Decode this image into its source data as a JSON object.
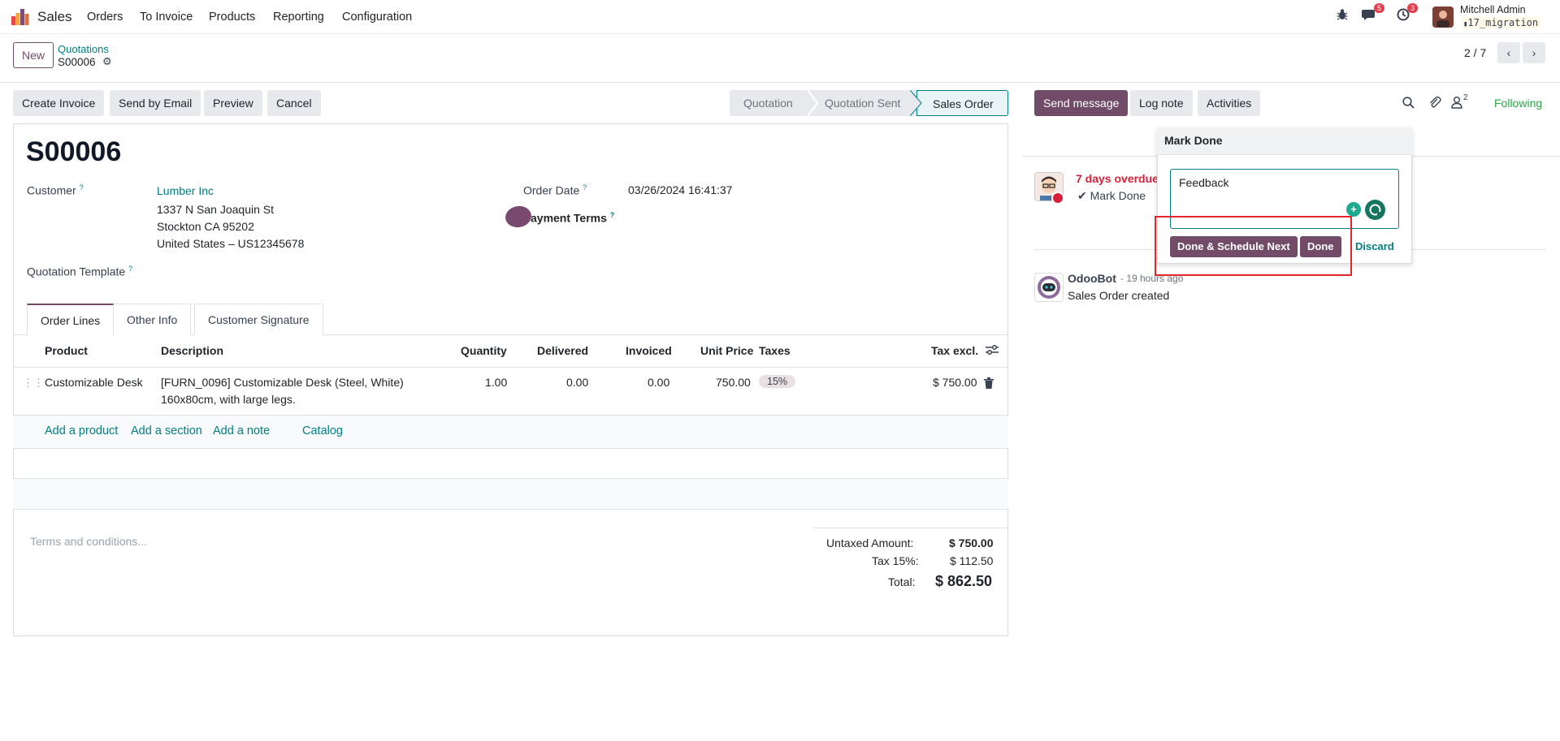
{
  "navbar": {
    "app_name": "Sales",
    "menu": [
      "Orders",
      "To Invoice",
      "Products",
      "Reporting",
      "Configuration"
    ],
    "messages_count": "5",
    "activities_count": "3",
    "user_name": "Mitchell Admin",
    "db_name": "17_migration"
  },
  "control_panel": {
    "new_label": "New",
    "breadcrumb_parent": "Quotations",
    "breadcrumb_current": "S00006",
    "pager": "2 / 7"
  },
  "actions": {
    "create_invoice": "Create Invoice",
    "send_by_email": "Send by Email",
    "preview": "Preview",
    "cancel": "Cancel"
  },
  "statusbar": [
    "Quotation",
    "Quotation Sent",
    "Sales Order"
  ],
  "form": {
    "name": "S00006",
    "customer_label": "Customer",
    "customer_name": "Lumber Inc",
    "address_line1": "1337 N San Joaquin St",
    "address_line2": "Stockton CA 95202",
    "address_line3": "United States – US12345678",
    "quotation_template_label": "Quotation Template",
    "order_date_label": "Order Date",
    "order_date": "03/26/2024 16:41:37",
    "payment_terms_label": "ayment Terms",
    "help_mark": "?"
  },
  "tabs": [
    "Order Lines",
    "Other Info",
    "Customer Signature"
  ],
  "table": {
    "headers": [
      "Product",
      "Description",
      "Quantity",
      "Delivered",
      "Invoiced",
      "Unit Price",
      "Taxes",
      "Tax excl."
    ],
    "row": {
      "product": "Customizable Desk",
      "description_line1": "[FURN_0096] Customizable Desk (Steel, White)",
      "description_line2": "160x80cm, with large legs.",
      "quantity": "1.00",
      "delivered": "0.00",
      "invoiced": "0.00",
      "unit_price": "750.00",
      "tax": "15%",
      "subtotal": "$ 750.00"
    },
    "add_product": "Add a product",
    "add_section": "Add a section",
    "add_note": "Add a note",
    "catalog": "Catalog"
  },
  "totals": {
    "terms_placeholder": "Terms and conditions...",
    "untaxed_label": "Untaxed Amount:",
    "untaxed_value": "$ 750.00",
    "tax_label": "Tax 15%:",
    "tax_value": "$ 112.50",
    "total_label": "Total:",
    "total_value": "$ 862.50"
  },
  "chatter": {
    "send_message": "Send message",
    "log_note": "Log note",
    "activities": "Activities",
    "followers_count": "2",
    "following": "Following",
    "overdue": "7 days overdue",
    "mark_done": "Mark Done",
    "bot_name": "OdooBot",
    "bot_time": "- 19 hours ago",
    "bot_message": "Sales Order created"
  },
  "popover": {
    "title": "Mark Done",
    "feedback_value": "Feedback",
    "done_schedule_next": "Done & Schedule Next",
    "done": "Done",
    "discard": "Discard"
  },
  "colors": {
    "brand": "#714b67",
    "link": "#017e84",
    "danger": "#d9203a",
    "following": "#28a745"
  }
}
